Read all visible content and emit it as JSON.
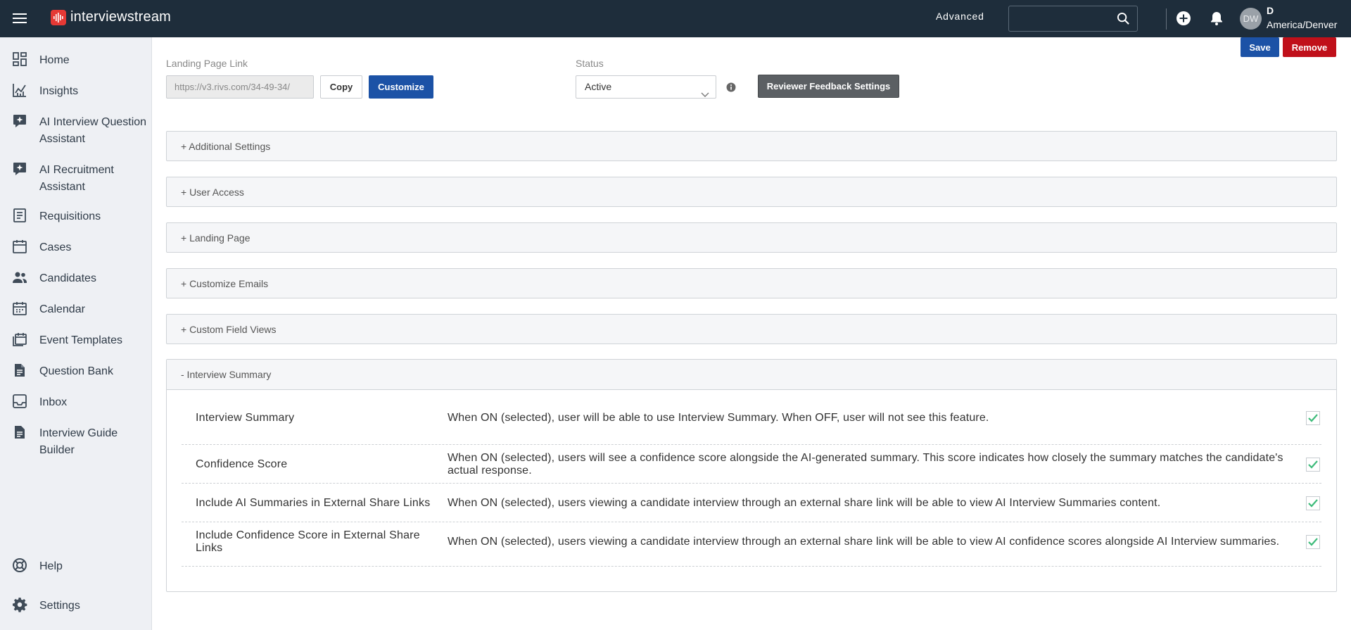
{
  "topbar": {
    "brand": "interviewstream",
    "advanced_label": "Advanced",
    "search_placeholder": "",
    "avatar_initials": "DW",
    "user_initial": "D",
    "user_timezone": "America/Denver"
  },
  "sidebar": {
    "items": [
      {
        "label": "Home",
        "icon": "dashboard-grid-icon"
      },
      {
        "label": "Insights",
        "icon": "chart-trend-icon"
      },
      {
        "label": "AI Interview Question Assistant",
        "icon": "ai-sparkle-icon"
      },
      {
        "label": "AI Recruitment Assistant",
        "icon": "ai-sparkle-icon"
      },
      {
        "label": "Requisitions",
        "icon": "document-list-icon"
      },
      {
        "label": "Cases",
        "icon": "calendar-icon"
      },
      {
        "label": "Candidates",
        "icon": "people-icon"
      },
      {
        "label": "Calendar",
        "icon": "calendar-grid-icon"
      },
      {
        "label": "Event Templates",
        "icon": "event-template-icon"
      },
      {
        "label": "Question Bank",
        "icon": "question-document-icon"
      },
      {
        "label": "Inbox",
        "icon": "inbox-icon"
      },
      {
        "label": "Interview Guide Builder",
        "icon": "guide-document-icon"
      }
    ],
    "bottom": [
      {
        "label": "Help",
        "icon": "help-lifebuoy-icon"
      },
      {
        "label": "Settings",
        "icon": "gear-icon"
      }
    ]
  },
  "actions": {
    "save_label": "Save",
    "remove_label": "Remove"
  },
  "landing": {
    "label": "Landing Page Link",
    "url_value": "https://v3.rivs.com/34-49-34/",
    "copy_label": "Copy",
    "customize_label": "Customize"
  },
  "status": {
    "label": "Status",
    "value": "Active",
    "reviewer_button_label": "Reviewer Feedback Settings"
  },
  "panels": [
    {
      "title": "+ Additional Settings"
    },
    {
      "title": "+ User Access"
    },
    {
      "title": "+ Landing Page"
    },
    {
      "title": "+ Customize Emails"
    },
    {
      "title": "+ Custom Field Views"
    }
  ],
  "interview_summary": {
    "title": "- Interview Summary",
    "rows": [
      {
        "name": "Interview Summary",
        "description": "When ON (selected), user will be able to use Interview Summary. When OFF, user will not see this feature.",
        "checked": true
      },
      {
        "name": "Confidence Score",
        "description": "When ON (selected), users will see a confidence score alongside the AI-generated summary. This score indicates how closely the summary matches the candidate's actual response.",
        "checked": true
      },
      {
        "name": "Include AI Summaries in External Share Links",
        "description": "When ON (selected), users viewing a candidate interview through an external share link will be able to view AI Interview Summaries content.",
        "checked": true
      },
      {
        "name": "Include Confidence Score in External Share Links",
        "description": "When ON (selected), users viewing a candidate interview through an external share link will be able to view AI confidence scores alongside AI Interview summaries.",
        "checked": true
      }
    ]
  },
  "colors": {
    "topbar_bg": "#1e2d3b",
    "primary": "#1c52a6",
    "danger": "#c0101a",
    "reviewer_btn": "#5b5f63",
    "check_green": "#3dbb7a",
    "sidebar_bg": "#eef0f4"
  }
}
